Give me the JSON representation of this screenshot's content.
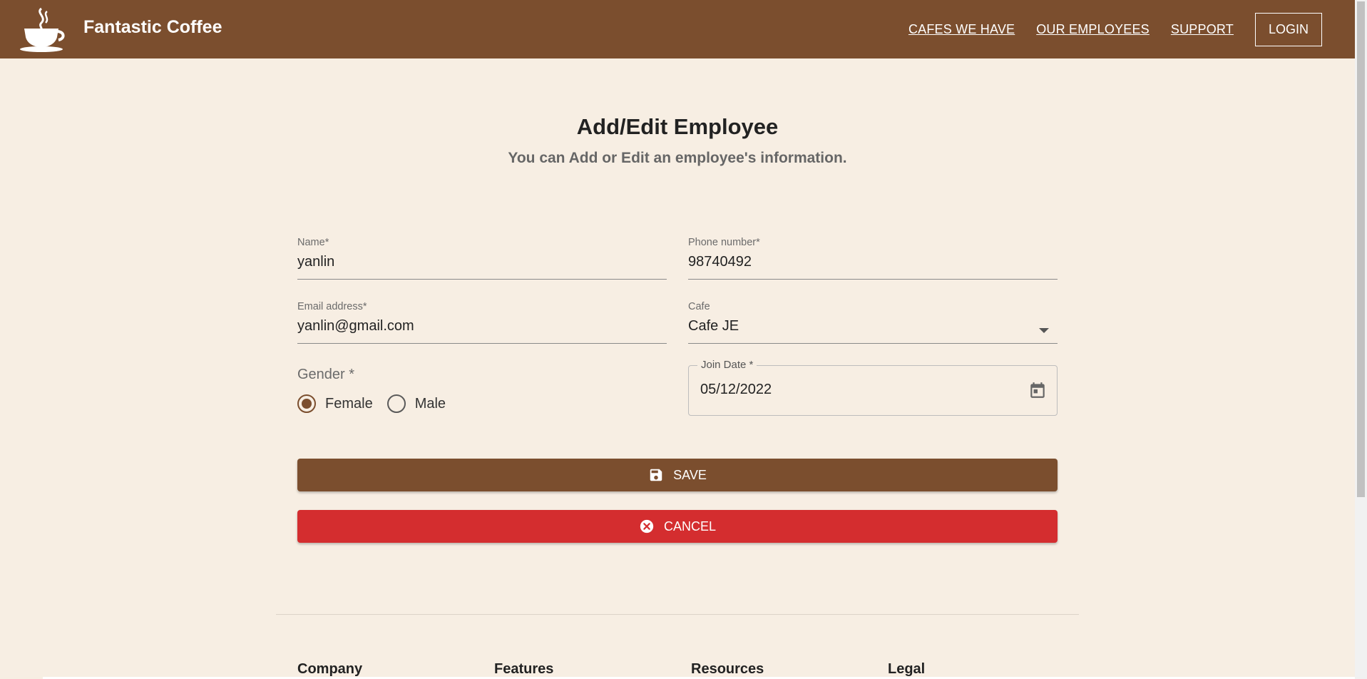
{
  "navbar": {
    "brand": "Fantastic Coffee",
    "links": [
      "CAFES WE HAVE",
      "OUR EMPLOYEES",
      "SUPPORT"
    ],
    "login_label": "LOGIN",
    "color": "#7b4e2e"
  },
  "page": {
    "title": "Add/Edit Employee",
    "subtitle": "You can Add or Edit an employee's information."
  },
  "form": {
    "name": {
      "label": "Name",
      "required_mark": "*",
      "value": "yanlin"
    },
    "phone": {
      "label": "Phone number",
      "required_mark": "*",
      "value": "98740492"
    },
    "email": {
      "label": "Email address",
      "required_mark": "*",
      "value": "yanlin@gmail.com"
    },
    "cafe": {
      "label": "Cafe",
      "value": "Cafe JE"
    },
    "gender": {
      "label": "Gender *",
      "options": [
        "Female",
        "Male"
      ],
      "selected": "Female"
    },
    "join_date": {
      "label": "Join Date *",
      "value": "05/12/2022"
    }
  },
  "buttons": {
    "save_label": "SAVE",
    "cancel_label": "CANCEL",
    "save_color": "#7b4e2e",
    "cancel_color": "#d42d2f"
  },
  "footer": {
    "columns": [
      "Company",
      "Features",
      "Resources",
      "Legal"
    ]
  },
  "icons": {
    "logo": "coffee-cup-icon",
    "save": "floppy-disk-icon",
    "cancel": "cancel-circle-icon",
    "calendar": "calendar-icon",
    "dropdown": "caret-down-icon"
  }
}
